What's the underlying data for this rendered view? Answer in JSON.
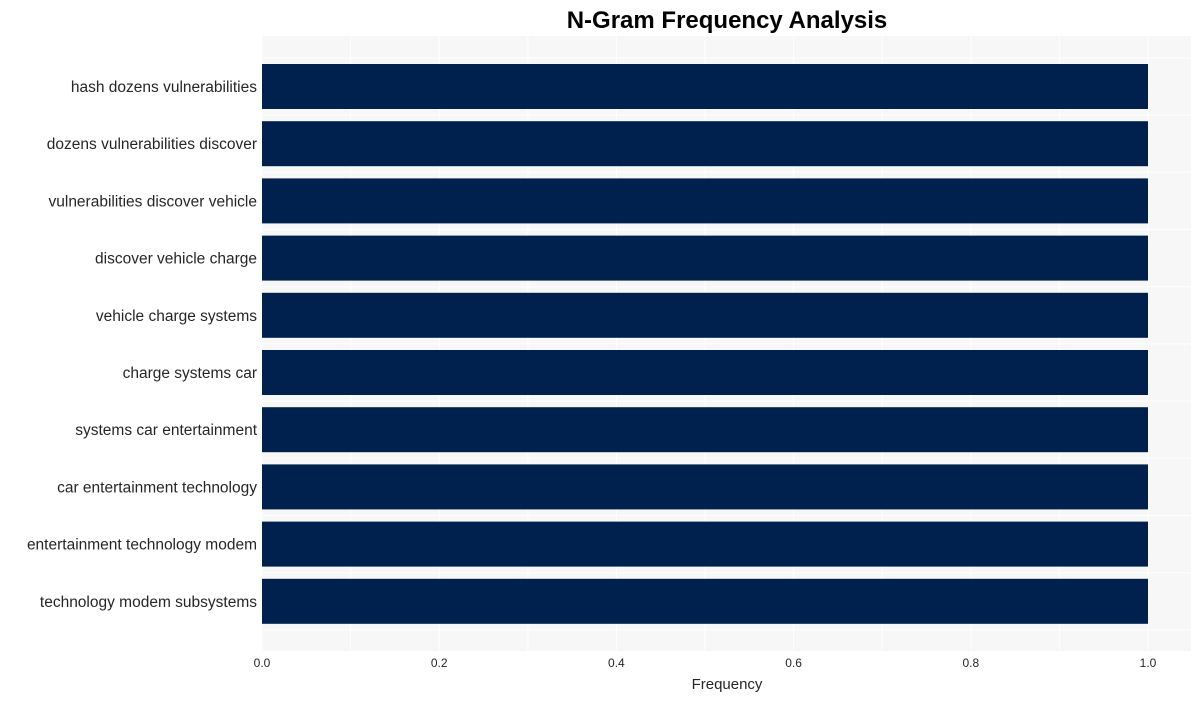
{
  "chart_data": {
    "type": "bar",
    "orientation": "horizontal",
    "title": "N-Gram Frequency Analysis",
    "xlabel": "Frequency",
    "ylabel": "",
    "categories": [
      "hash dozens vulnerabilities",
      "dozens vulnerabilities discover",
      "vulnerabilities discover vehicle",
      "discover vehicle charge",
      "vehicle charge systems",
      "charge systems car",
      "systems car entertainment",
      "car entertainment technology",
      "entertainment technology modem",
      "technology modem subsystems"
    ],
    "values": [
      1,
      1,
      1,
      1,
      1,
      1,
      1,
      1,
      1,
      1
    ],
    "xlim": [
      0,
      1.05
    ],
    "xticks": [
      0.0,
      0.2,
      0.4,
      0.6,
      0.8,
      1.0
    ],
    "xtick_labels": [
      "0.0",
      "0.2",
      "0.4",
      "0.6",
      "0.8",
      "1.0"
    ],
    "grid": true,
    "legend": "none",
    "colors": {
      "bar": "#00214d",
      "plot_background": "#f7f7f7",
      "grid": "#ffffff"
    }
  }
}
